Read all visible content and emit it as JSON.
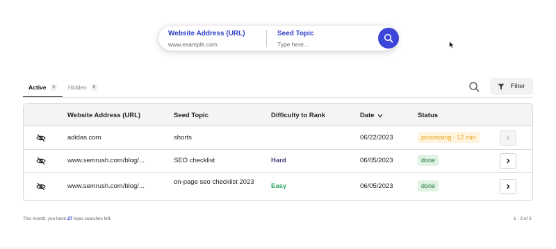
{
  "search": {
    "url_label": "Website Address (URL)",
    "url_placeholder": "www.example.com",
    "seed_label": "Seed Topic",
    "seed_placeholder": "Type here..."
  },
  "tabs": [
    {
      "label": "Active",
      "count": "3"
    },
    {
      "label": "Hidden",
      "count": "0"
    }
  ],
  "toolbar": {
    "filter_label": "Filter"
  },
  "table": {
    "headers": {
      "url": "Website Address (URL)",
      "seed": "Seed Topic",
      "difficulty": "Difficulty to Rank",
      "date": "Date",
      "status": "Status"
    },
    "rows": [
      {
        "url": "adidas.com",
        "seed": "shorts",
        "difficulty": "",
        "date": "06/22/2023",
        "status": "processing - 12 min"
      },
      {
        "url": "www.semrush.com/blog/...",
        "seed": "SEO checklist",
        "difficulty": "Hard",
        "date": "06/05/2023",
        "status": "done"
      },
      {
        "url": "www.semrush.com/blog/...",
        "seed": "on-page seo checklist 2023",
        "difficulty": "Easy",
        "date": "06/05/2023",
        "status": "done"
      }
    ]
  },
  "footer": {
    "prefix": "This month, you have",
    "count": "27",
    "suffix": "topic searches left.",
    "pagination": "1 - 3 of 3"
  },
  "colors": {
    "accent": "#3b46d9",
    "hard": "#3b3f7a",
    "easy": "#2b9e5a",
    "processing": "#e8a21a",
    "done": "#267a42"
  },
  "icons": [
    "search-icon",
    "cursor-icon",
    "filter-icon",
    "eye-off-icon",
    "chevron-down-icon",
    "chevron-right-icon"
  ]
}
